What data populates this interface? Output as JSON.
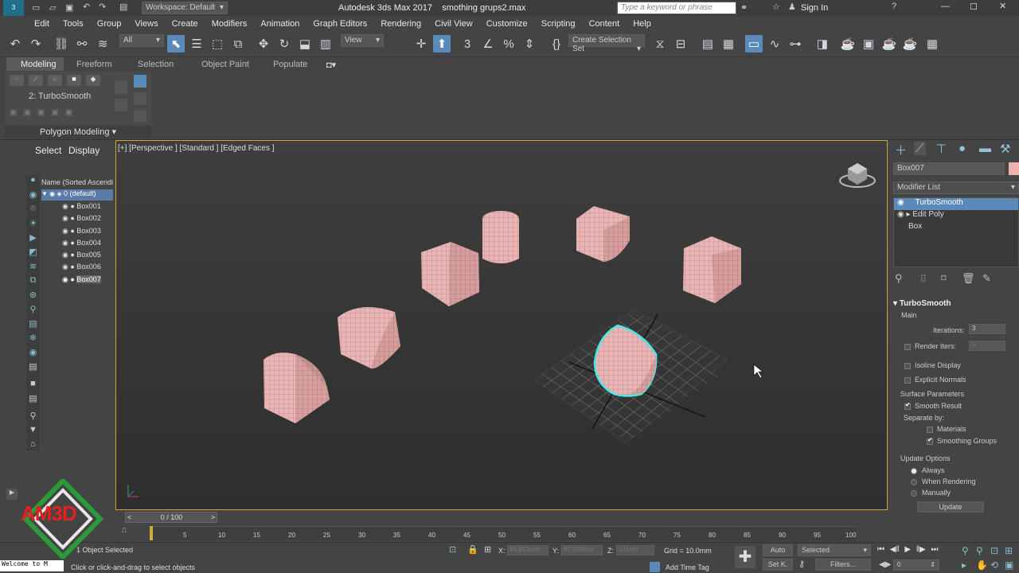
{
  "title": {
    "app": "Autodesk 3ds Max 2017",
    "file": "smothing grups2.max",
    "workspace": "Workspace: Default",
    "search_placeholder": "Type a keyword or phrase",
    "sign_in": "Sign In"
  },
  "menu": [
    "Edit",
    "Tools",
    "Group",
    "Views",
    "Create",
    "Modifiers",
    "Animation",
    "Graph Editors",
    "Rendering",
    "Civil View",
    "Customize",
    "Scripting",
    "Content",
    "Help"
  ],
  "toolbar": {
    "filter": "All",
    "view": "View",
    "selection_set": "Create Selection Set"
  },
  "ribbon": {
    "tabs": [
      "Modeling",
      "Freeform",
      "Selection",
      "Object Paint",
      "Populate"
    ],
    "modifier_label": "2: TurboSmooth",
    "panel_label": "Polygon Modeling"
  },
  "scene_explorer": {
    "tabs": [
      "Select",
      "Display"
    ],
    "header": "Name (Sorted Ascendi",
    "layer": "0 (default)",
    "items": [
      "Box001",
      "Box002",
      "Box003",
      "Box004",
      "Box005",
      "Box006",
      "Box007"
    ]
  },
  "viewport": {
    "label": "[+] [Perspective ] [Standard ] [Edged Faces ]"
  },
  "cmd": {
    "object_name": "Box007",
    "modifier_list": "Modifier List",
    "stack": [
      "TurboSmooth",
      "Edit Poly",
      "Box"
    ],
    "rollout_title": "TurboSmooth",
    "main": "Main",
    "iterations_label": "Iterations:",
    "iterations_value": "3",
    "render_iters_label": "Render Iters:",
    "render_iters_value": "0",
    "isoline": "Isoline Display",
    "explicit_normals": "Explicit Normals",
    "surface_params": "Surface Parameters",
    "smooth_result": "Smooth Result",
    "separate_by": "Separate by:",
    "materials": "Materials",
    "smoothing_groups": "Smoothing Groups",
    "update_options": "Update Options",
    "always": "Always",
    "when_rendering": "When Rendering",
    "manually": "Manually",
    "update_button": "Update"
  },
  "timeline": {
    "frame": "0 / 100",
    "ticks": [
      "0",
      "5",
      "10",
      "15",
      "20",
      "25",
      "30",
      "35",
      "40",
      "45",
      "50",
      "55",
      "60",
      "65",
      "70",
      "75",
      "80",
      "85",
      "90",
      "95",
      "100"
    ]
  },
  "status": {
    "selected": "1 Object Selected",
    "prompt": "Click or click-and-drag to select objects",
    "x_label": "X:",
    "x_value": "94.813mm",
    "y_label": "Y:",
    "y_value": "87.608mm",
    "z_label": "Z:",
    "z_value": "0.0mm",
    "grid": "Grid = 10.0mm",
    "add_time_tag": "Add Time Tag",
    "auto": "Auto",
    "set_key": "Set K.",
    "key_mode": "Selected",
    "filters": "Filters...",
    "frame_field": "0",
    "maxscript": "Welcome to M"
  },
  "watermark": "AM3D"
}
